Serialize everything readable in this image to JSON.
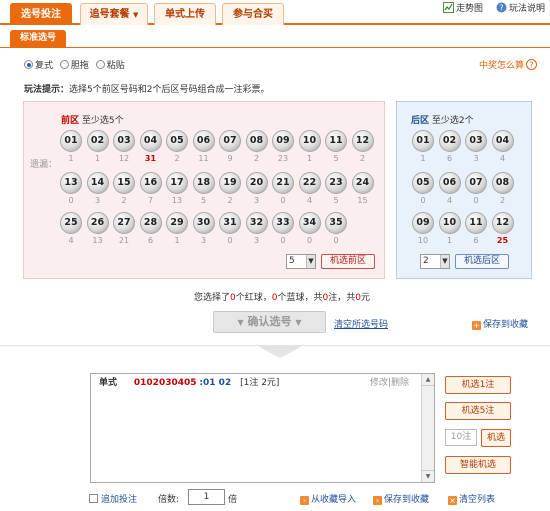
{
  "tabs": [
    "选号投注",
    "追号套餐",
    "单式上传",
    "参与合买"
  ],
  "top_links": {
    "trend": "走势图",
    "help": "玩法说明"
  },
  "subtab": "标准选号",
  "modes": [
    "复式",
    "胆拖",
    "粘贴"
  ],
  "prize_link": "中奖怎么算",
  "tip": {
    "label": "玩法提示：",
    "text": "选择5个前区号码和2个后区号码组合成一注彩票。"
  },
  "front": {
    "title": "前区",
    "subtitle": "至少选5个",
    "miss_label": "遗漏：",
    "balls": [
      "01",
      "02",
      "03",
      "04",
      "05",
      "06",
      "07",
      "08",
      "09",
      "10",
      "11",
      "12",
      "13",
      "14",
      "15",
      "16",
      "17",
      "18",
      "19",
      "20",
      "21",
      "22",
      "23",
      "24",
      "25",
      "26",
      "27",
      "28",
      "29",
      "30",
      "31",
      "32",
      "33",
      "34",
      "35"
    ],
    "miss": [
      "1",
      "1",
      "12",
      "31",
      "2",
      "11",
      "9",
      "2",
      "23",
      "1",
      "5",
      "2",
      "0",
      "3",
      "2",
      "7",
      "13",
      "5",
      "2",
      "3",
      "0",
      "4",
      "5",
      "15",
      "4",
      "13",
      "21",
      "6",
      "1",
      "3",
      "0",
      "3",
      "0",
      "0",
      "0"
    ],
    "select_value": "5",
    "random_label": "机选前区"
  },
  "back": {
    "title": "后区",
    "subtitle": "至少选2个",
    "balls": [
      "01",
      "02",
      "03",
      "04",
      "05",
      "06",
      "07",
      "08",
      "09",
      "10",
      "11",
      "12"
    ],
    "miss": [
      "1",
      "6",
      "3",
      "4",
      "0",
      "4",
      "0",
      "2",
      "10",
      "1",
      "6",
      "25"
    ],
    "select_value": "2",
    "random_label": "机选后区"
  },
  "summary": {
    "p1": "您选择了",
    "n1": "0",
    "p2": "个红球，",
    "n2": "0",
    "p3": "个蓝球，共",
    "n3": "0",
    "p4": "注，共",
    "n4": "0",
    "p5": "元"
  },
  "confirm_label": "确认选号",
  "clear_label": "清空所选号码",
  "save_label": "保存到收藏",
  "entry": {
    "type": "单式",
    "front": [
      "01",
      "02",
      "03",
      "04",
      "05"
    ],
    "back": [
      "01",
      "02"
    ],
    "note": "[1注 2元]",
    "edit": "修改",
    "del": "删除"
  },
  "right_buttons": {
    "r1": "机选1注",
    "r5": "机选5注",
    "count": "10注",
    "random": "机选",
    "smart": "智能机选"
  },
  "bottom": {
    "append": "追加投注",
    "multiple_label": "倍数:",
    "multiple": "1",
    "unit": "倍",
    "import": "从收藏导入",
    "save": "保存到收藏",
    "clear": "清空列表"
  },
  "colors": {
    "accent": "#ea6a10",
    "red": "#c00000",
    "blue": "#1f4f9a"
  }
}
